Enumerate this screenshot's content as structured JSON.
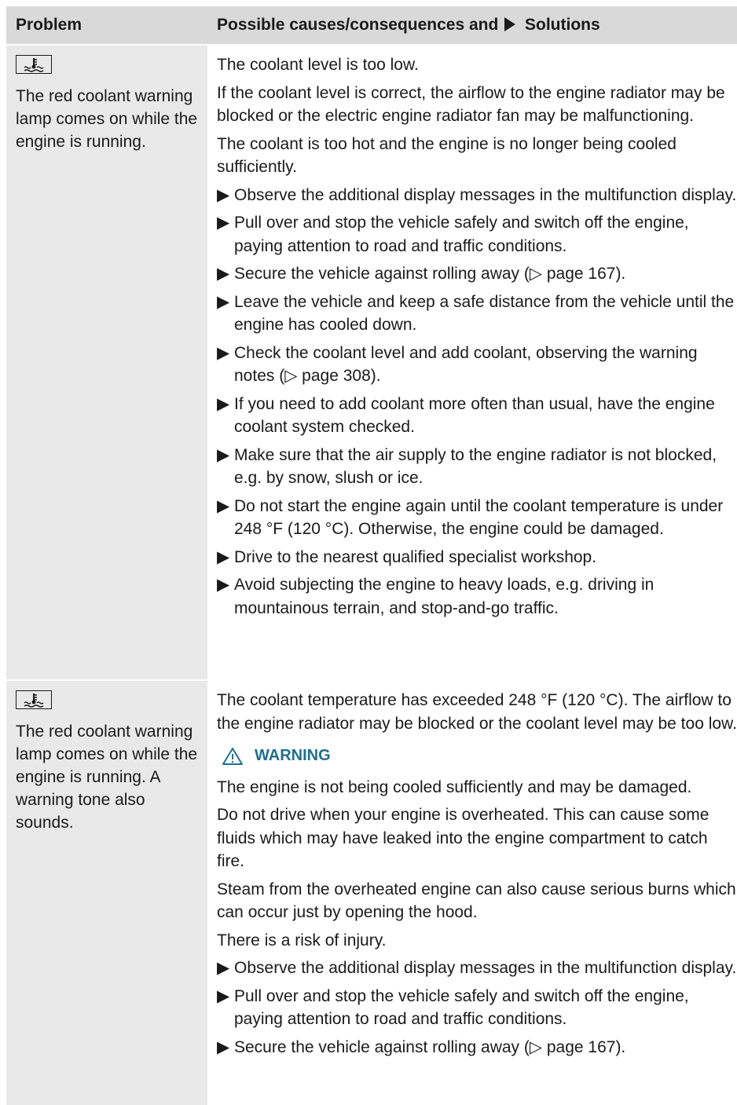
{
  "header": {
    "col1": "Problem",
    "col2_pre": "Possible causes/consequences and",
    "col2_post": "Solutions"
  },
  "rows": [
    {
      "icon": "coolant-temperature-icon",
      "problem": "The red coolant warning lamp comes on while the engine is running.",
      "paras": [
        "The coolant level is too low.",
        "If the coolant level is correct, the airflow to the engine radiator may be blocked or the electric engine radiator fan may be malfunctioning.",
        "The coolant is too hot and the engine is no longer being cooled sufficiently."
      ],
      "bullets": [
        "Observe the additional display messages in the multifunction display.",
        "Pull over and stop the vehicle safely and switch off the engine, paying attention to road and traffic conditions.",
        "Secure the vehicle against rolling away (▷ page 167).",
        "Leave the vehicle and keep a safe distance from the vehicle until the engine has cooled down.",
        "Check the coolant level and add coolant, observing the warning notes (▷ page 308).",
        "If you need to add coolant more often than usual, have the engine coolant system checked.",
        "Make sure that the air supply to the engine radiator is not blocked, e.g. by snow, slush or ice.",
        "Do not start the engine again until the coolant temperature is under 248 °F (120 °C). Otherwise, the engine could be damaged.",
        "Drive to the nearest qualified specialist workshop.",
        "Avoid subjecting the engine to heavy loads, e.g. driving in mountainous terrain, and stop-and-go traffic."
      ]
    },
    {
      "icon": "coolant-temperature-icon",
      "problem": "The red coolant warning lamp comes on while the engine is running. A warning tone also sounds.",
      "intro": "The coolant temperature has exceeded 248 °F (120 °C). The airflow to the engine radiator may be blocked or the coolant level may be too low.",
      "warning_label": "WARNING",
      "warning_paras": [
        "The engine is not being cooled sufficiently and may be damaged.",
        "Do not drive when your engine is overheated. This can cause some fluids which may have leaked into the engine compartment to catch fire.",
        "Steam from the overheated engine can also cause serious burns which can occur just by opening the hood.",
        "There is a risk of injury."
      ],
      "bullets": [
        "Observe the additional display messages in the multifunction display.",
        "Pull over and stop the vehicle safely and switch off the engine, paying attention to road and traffic conditions.",
        "Secure the vehicle against rolling away (▷ page 167)."
      ]
    }
  ],
  "colors": {
    "header_bg": "#d9d9d9",
    "left_bg": "#e9e9e9",
    "warning": "#1f6f8b"
  }
}
